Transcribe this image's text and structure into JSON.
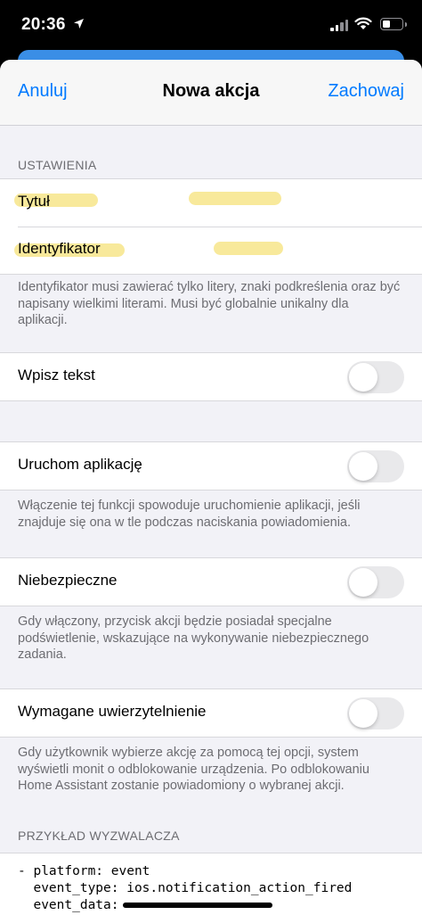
{
  "status_bar": {
    "time": "20:36"
  },
  "nav": {
    "cancel_label": "Anuluj",
    "title": "Nowa akcja",
    "save_label": "Zachowaj"
  },
  "settings": {
    "header": "USTAWIENIA",
    "title_label": "Tytuł",
    "identifier_label": "Identyfikator",
    "identifier_footer": "Identyfikator musi zawierać tylko litery, znaki podkreślenia oraz być napisany wielkimi literami. Musi być globalnie unikalny dla aplikacji."
  },
  "text_input": {
    "label": "Wpisz tekst",
    "enabled": false
  },
  "launch_app": {
    "label": "Uruchom aplikację",
    "enabled": false,
    "footer": "Włączenie tej funkcji spowoduje uruchomienie aplikacji, jeśli znajduje się ona w tle podczas naciskania powiadomienia."
  },
  "destructive": {
    "label": "Niebezpieczne",
    "enabled": false,
    "footer": "Gdy włączony, przycisk akcji będzie posiadał specjalne podświetlenie, wskazujące na wykonywanie niebezpiecznego zadania."
  },
  "auth_required": {
    "label": "Wymagane uwierzytelnienie",
    "enabled": false,
    "footer": "Gdy użytkownik wybierze akcję za pomocą tej opcji, system wyświetli monit o odblokowanie urządzenia. Po odblokowaniu Home Assistant zostanie powiadomiony o wybranej akcji."
  },
  "trigger_example": {
    "header": "PRZYKŁAD WYZWALACZA",
    "line1": "- platform: event",
    "line2": "  event_type: ios.notification_action_fired",
    "line3": "  event_data:"
  },
  "colors": {
    "accent": "#007aff",
    "background": "#f2f2f7",
    "highlight": "#f6e27a"
  }
}
